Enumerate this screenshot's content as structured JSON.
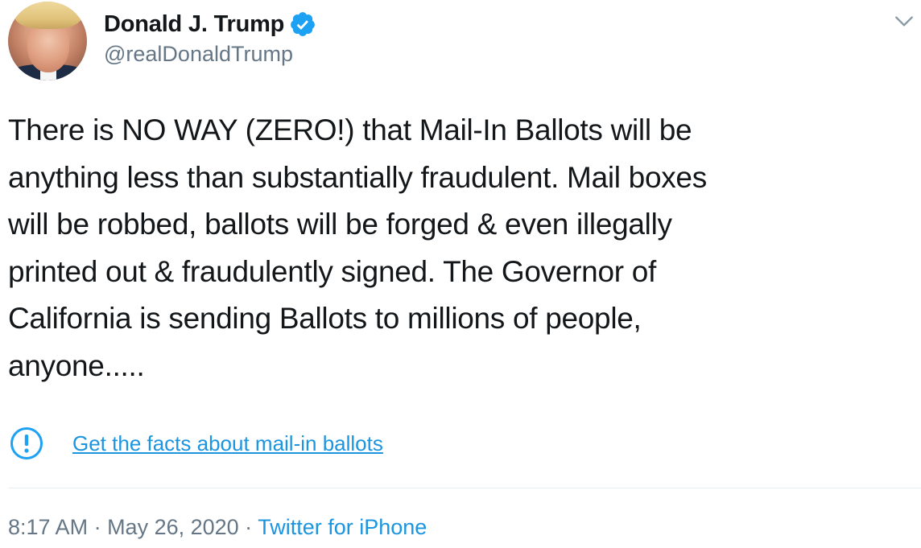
{
  "author": {
    "display_name": "Donald J. Trump",
    "handle": "@realDonaldTrump",
    "verified": true,
    "avatar_icon": "profile-photo"
  },
  "tweet": {
    "text": "There is NO WAY (ZERO!) that Mail-In Ballots will be\nanything less than substantially fraudulent. Mail boxes\nwill be robbed, ballots will be forged & even illegally\nprinted out & fraudulently signed. The Governor of\nCalifornia is sending Ballots to millions of people,\nanyone....."
  },
  "notice": {
    "icon": "exclamation-circle-icon",
    "link_text": "Get the facts about mail-in ballots"
  },
  "meta": {
    "time": "8:17 AM",
    "separator1": " · ",
    "date": "May 26, 2020",
    "separator2": " · ",
    "source": "Twitter for iPhone"
  },
  "colors": {
    "text": "#14171a",
    "secondary": "#657786",
    "accent": "#1b95e0",
    "divider": "#e6ecf0"
  }
}
